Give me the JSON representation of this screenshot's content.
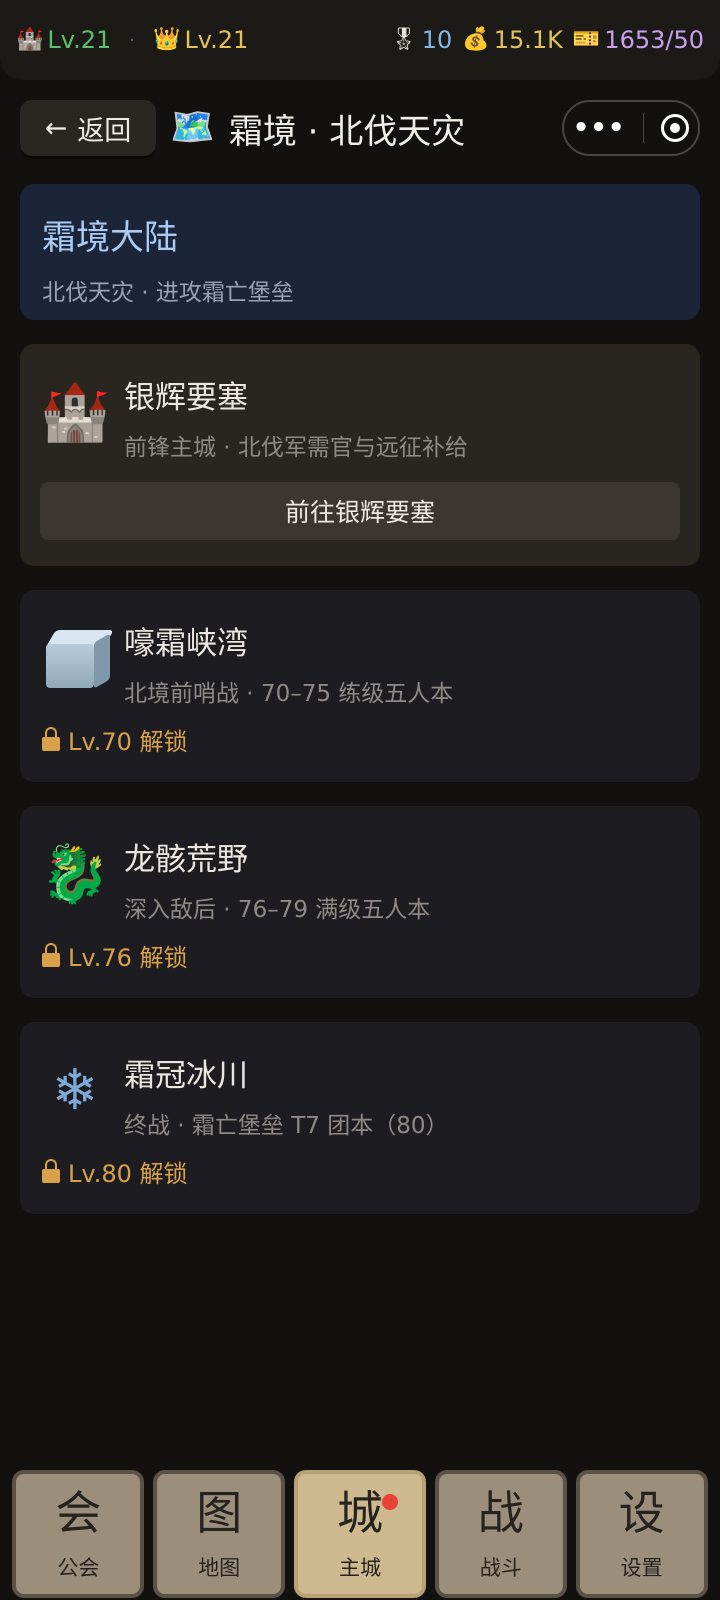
{
  "statusbar": {
    "castle_level": "Lv.21",
    "crown_level": "Lv.21",
    "medals": "10",
    "gold": "15.1K",
    "tickets": "1653/50"
  },
  "topbar": {
    "back_label": "返回",
    "title": "霜境 · 北伐天灾"
  },
  "region": {
    "name": "霜境大陆",
    "subtitle": "北伐天灾 · 进攻霜亡堡垒"
  },
  "fortress": {
    "name": "银辉要塞",
    "subtitle": "前锋主城 · 北伐军需官与远征补给",
    "button_label": "前往银辉要塞"
  },
  "dungeons": [
    {
      "name": "嚎霜峡湾",
      "subtitle": "北境前哨战 · 70–75 练级五人本",
      "lock": "Lv.70 解锁"
    },
    {
      "name": "龙骸荒野",
      "subtitle": "深入敌后 · 76–79 满级五人本",
      "lock": "Lv.76 解锁"
    },
    {
      "name": "霜冠冰川",
      "subtitle": "终战 · 霜亡堡垒 T7 团本（80）",
      "lock": "Lv.80 解锁"
    }
  ],
  "nav": [
    {
      "glyph": "会",
      "label": "公会"
    },
    {
      "glyph": "图",
      "label": "地图"
    },
    {
      "glyph": "城",
      "label": "主城"
    },
    {
      "glyph": "战",
      "label": "战斗"
    },
    {
      "glyph": "设",
      "label": "设置"
    }
  ],
  "colors": {
    "background": "#121110",
    "region_title": "#a9ccf5",
    "lock": "#d9a24a",
    "nav_active": "#ceb98f",
    "notification": "#e8413a"
  },
  "icons": {
    "castle": "castle-icon",
    "crown": "crown-icon",
    "medal": "medal-icon",
    "money": "money-bag-icon",
    "ticket": "ticket-icon",
    "map": "world-map-icon",
    "fortress": "castle-icon",
    "dungeon1": "ice-cube-icon",
    "dungeon2": "dragon-icon",
    "dungeon3": "snowflake-icon",
    "lock": "lock-icon"
  }
}
